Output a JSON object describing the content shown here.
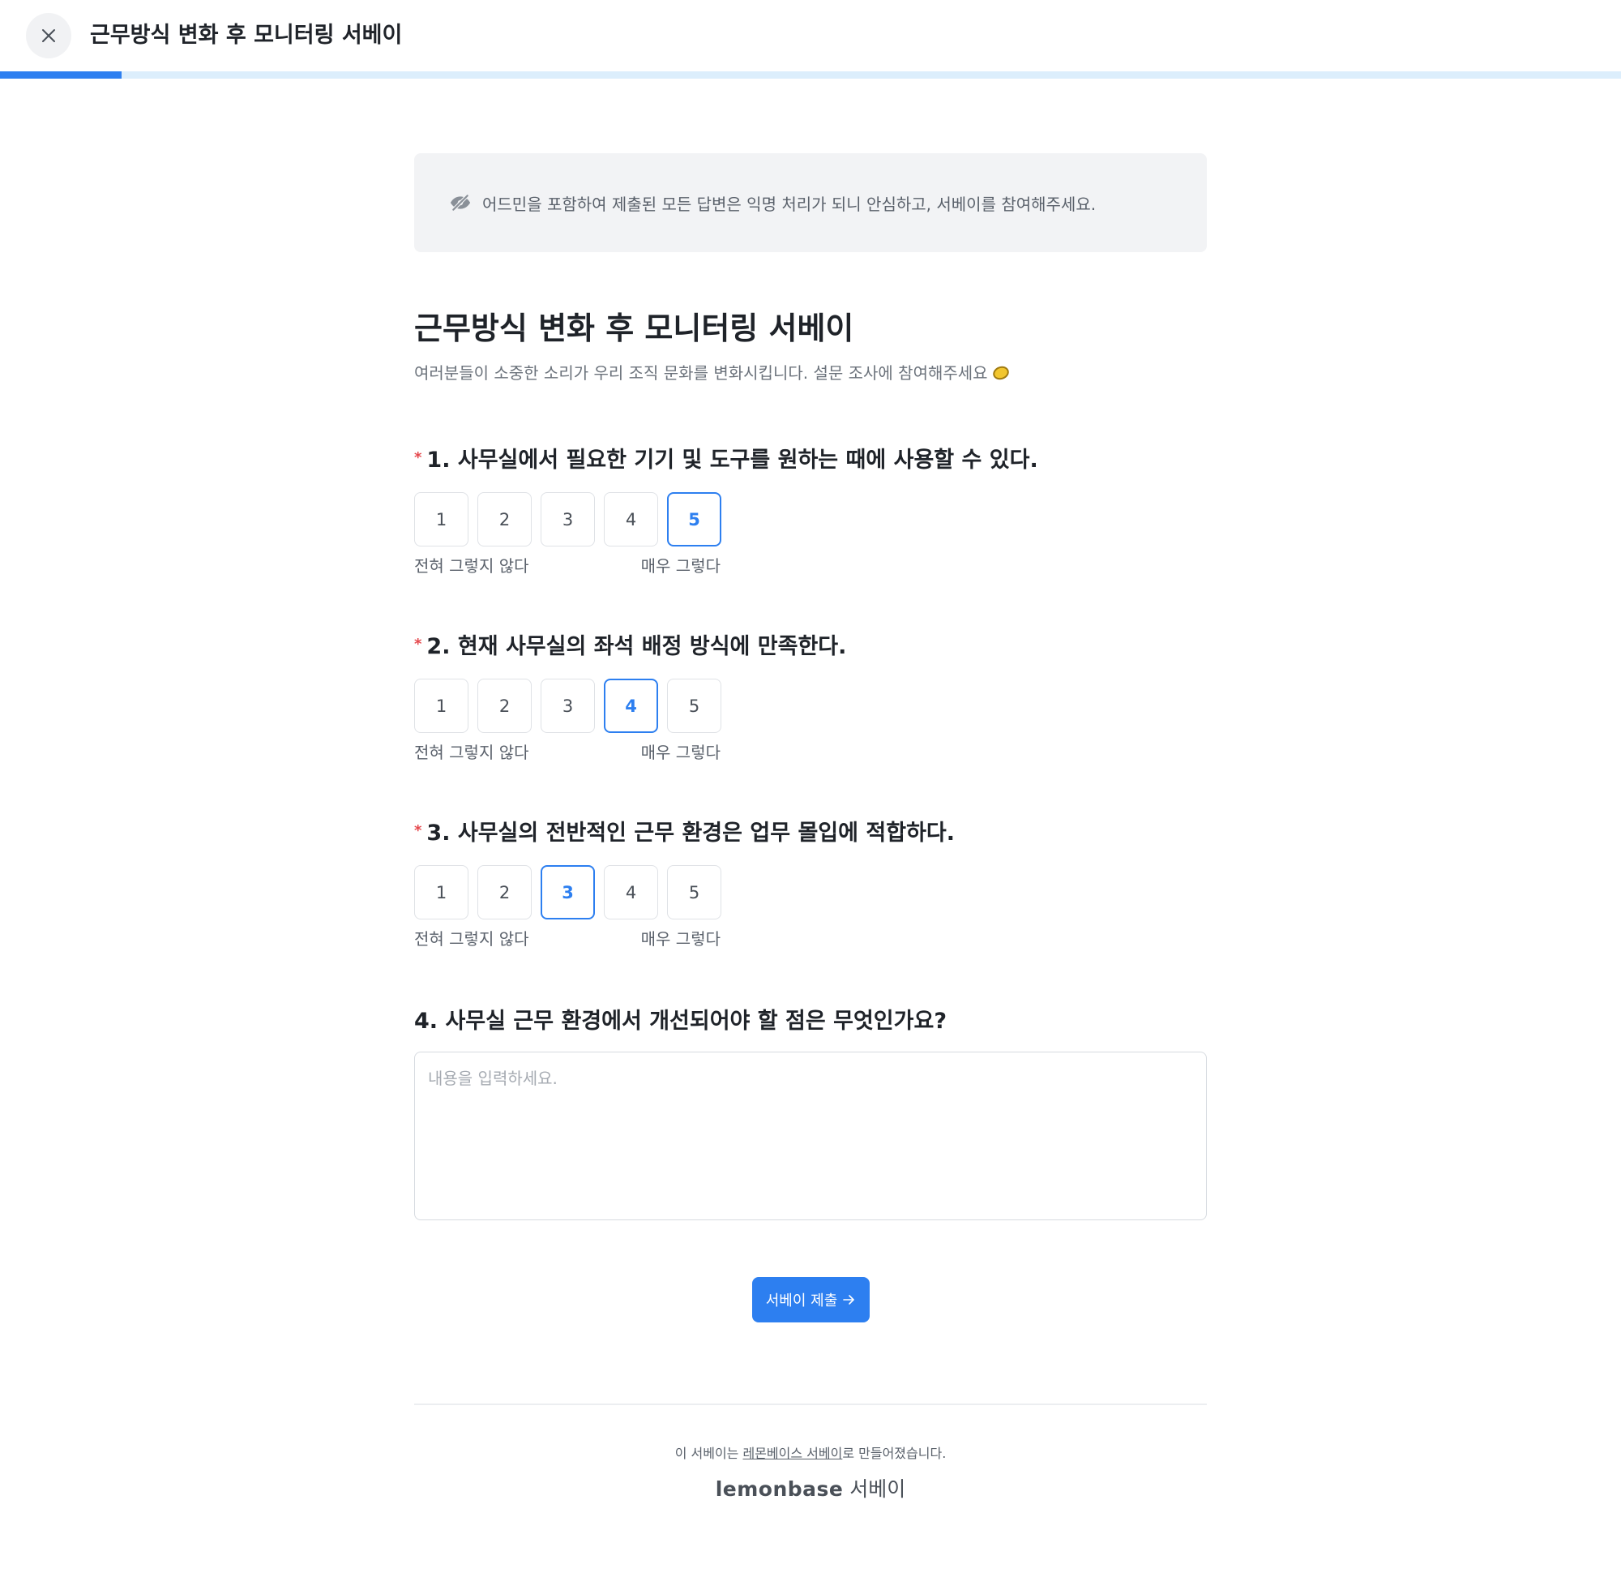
{
  "header": {
    "title": "근무방식 변화 후 모니터링 서베이",
    "close_icon": "close-icon"
  },
  "progress": {
    "value_percent": 7.5
  },
  "notice": {
    "icon": "eye-off-icon",
    "text": "어드민을 포함하여 제출된 모든 답변은 익명 처리가 되니 안심하고, 서베이를 참여해주세요."
  },
  "survey": {
    "title": "근무방식 변화 후 모니터링 서베이",
    "description": "여러분들이 소중한 소리가 우리 조직 문화를 변화시킵니다. 설문 조사에 참여해주세요",
    "description_icon": "lemon-icon"
  },
  "questions": [
    {
      "required_mark": "*",
      "title": "1. 사무실에서 필요한 기기 및 도구를 원하는 때에 사용할 수 있다.",
      "options": [
        "1",
        "2",
        "3",
        "4",
        "5"
      ],
      "selected": "5",
      "low_label": "전혀 그렇지 않다",
      "high_label": "매우 그렇다"
    },
    {
      "required_mark": "*",
      "title": "2. 현재 사무실의 좌석 배정 방식에 만족한다.",
      "options": [
        "1",
        "2",
        "3",
        "4",
        "5"
      ],
      "selected": "4",
      "low_label": "전혀 그렇지 않다",
      "high_label": "매우 그렇다"
    },
    {
      "required_mark": "*",
      "title": "3. 사무실의 전반적인 근무 환경은 업무 몰입에 적합하다.",
      "options": [
        "1",
        "2",
        "3",
        "4",
        "5"
      ],
      "selected": "3",
      "low_label": "전혀 그렇지 않다",
      "high_label": "매우 그렇다"
    }
  ],
  "open_question": {
    "title": "4. 사무실 근무 환경에서 개선되어야 할 점은 무엇인가요?",
    "placeholder": "내용을 입력하세요.",
    "value": ""
  },
  "submit": {
    "label": "서베이 제출",
    "icon": "arrow-right-icon",
    "color": "#2d7ff0"
  },
  "footer": {
    "prefix": "이 서베이는 ",
    "link": "레몬베이스 서베이",
    "suffix": "로 만들어졌습니다.",
    "brand_en": "lemonbase",
    "brand_ko": "서베이"
  },
  "colors": {
    "accent": "#2d7ff0",
    "progress_track": "#dceefc",
    "required": "#e5484d",
    "notice_bg": "#f2f3f5"
  }
}
